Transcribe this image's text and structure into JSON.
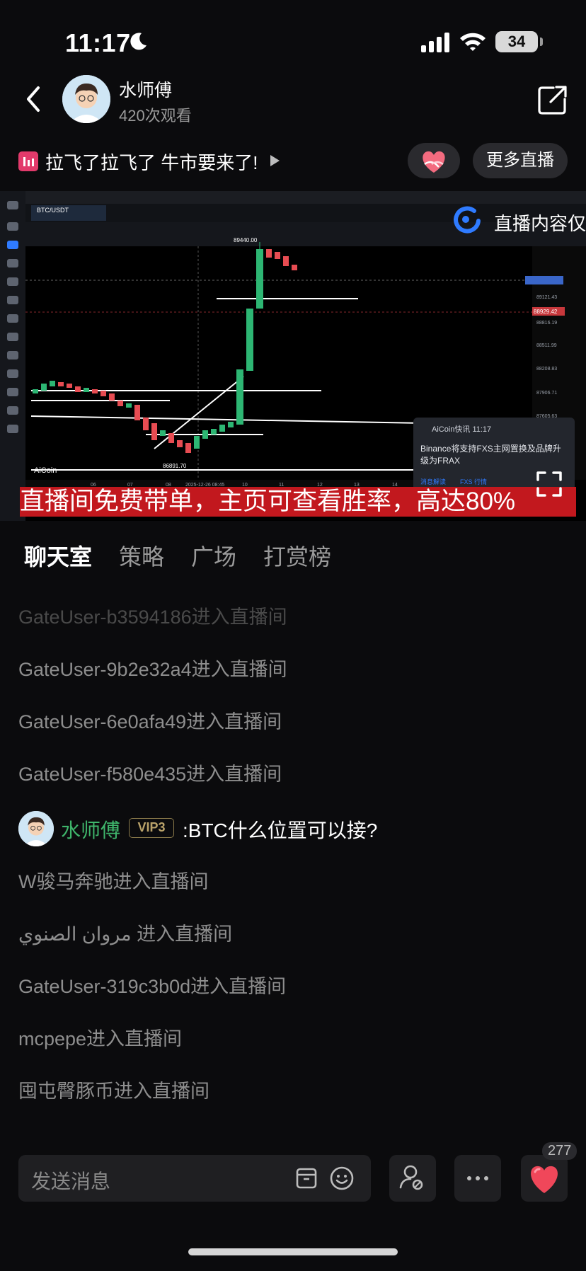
{
  "status_bar": {
    "time": "11:17",
    "battery": "34"
  },
  "header": {
    "host_name": "水师傅",
    "views": "420次观看"
  },
  "live": {
    "title": "拉飞了拉飞了 牛市要来了!",
    "more_live": "更多直播"
  },
  "video": {
    "banner": "直播间免费带单，主页可查看胜率，高达80%",
    "overlay_badge": "直播内容仅",
    "pair": "BTC/USDT",
    "price_label": "89440.00",
    "low_label": "86891.70",
    "current_price": "88929.42",
    "watermark": "AiCoin",
    "popup": {
      "source": "AiCoin快讯 11:17",
      "body": "Binance将支持FXS主网置换及品牌升级为FRAX",
      "tag1": "消息解读",
      "tag2": "FXS 行情"
    },
    "price_axis": [
      "89121.43",
      "88816.19",
      "88511.99",
      "88208.83",
      "87906.71",
      "87605.63"
    ],
    "time_axis": [
      "06",
      "07",
      "08",
      "2025-12-26 08:45",
      "10",
      "11",
      "12",
      "13",
      "14"
    ]
  },
  "tabs": [
    {
      "label": "聊天室",
      "active": true
    },
    {
      "label": "策略",
      "active": false
    },
    {
      "label": "广场",
      "active": false
    },
    {
      "label": "打赏榜",
      "active": false
    }
  ],
  "chat": {
    "messages": [
      "GateUser-b3594186进入直播间",
      "GateUser-9b2e32a4进入直播间",
      "GateUser-6e0afa49进入直播间",
      "GateUser-f580e435进入直播间",
      "W骏马奔驰进入直播间",
      "مروان الصنوي 进入直播间",
      "GateUser-319c3b0d进入直播间",
      "mcpepe进入直播间",
      "囤屯臀豚币进入直播间"
    ],
    "host_message": {
      "name": "水师傅",
      "vip": "VIP3",
      "text": ":BTC什么位置可以接?"
    }
  },
  "input": {
    "placeholder": "发送消息",
    "like_count": "277"
  },
  "icons": {
    "back": "chevron-left-icon",
    "share": "share-icon",
    "heart_hands": "heart-hands-icon",
    "fullscreen": "fullscreen-icon",
    "emoji": "emoji-icon",
    "gift_box": "box-icon",
    "user_settings": "user-gear-icon",
    "more": "more-icon",
    "like": "heart-icon"
  },
  "colors": {
    "accent_green": "#3fb56b",
    "banner_red": "#c2181e",
    "heart_red": "#f0475a"
  }
}
